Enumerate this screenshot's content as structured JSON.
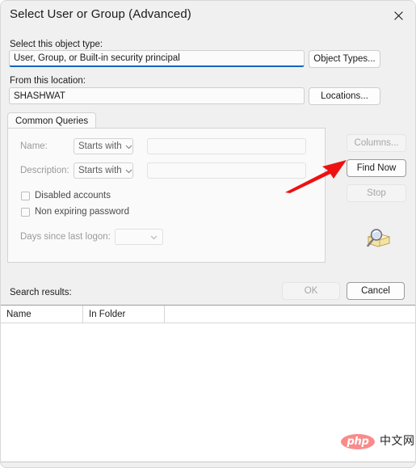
{
  "window": {
    "title": "Select User or Group (Advanced)",
    "close_icon": "close-icon"
  },
  "object_type": {
    "label": "Select this object type:",
    "value": "User, Group, or Built-in security principal",
    "button": "Object Types...",
    "focus_accent": "#1566b8"
  },
  "location": {
    "label": "From this location:",
    "value": "SHASHWAT",
    "button": "Locations..."
  },
  "tabs": [
    {
      "label": "Common Queries",
      "selected": true
    }
  ],
  "query": {
    "name": {
      "label": "Name:",
      "operator": "Starts with",
      "value": "",
      "placeholder": ""
    },
    "description": {
      "label": "Description:",
      "operator": "Starts with",
      "value": "",
      "placeholder": ""
    },
    "checkboxes": [
      {
        "label": "Disabled accounts",
        "checked": false
      },
      {
        "label": "Non expiring password",
        "checked": false
      }
    ],
    "days_since_logon": {
      "label": "Days since last logon:",
      "value": ""
    }
  },
  "side_buttons": [
    {
      "label": "Columns...",
      "enabled": false
    },
    {
      "label": "Find Now",
      "enabled": true,
      "default": true
    },
    {
      "label": "Stop",
      "enabled": false
    }
  ],
  "find_icon": "magnifier-folder-icon",
  "dialog_buttons": [
    {
      "label": "OK",
      "enabled": false
    },
    {
      "label": "Cancel",
      "enabled": true
    }
  ],
  "results": {
    "label": "Search results:",
    "columns": [
      "Name",
      "In Folder"
    ],
    "rows": []
  },
  "annotation": {
    "arrow_color": "#ee1111",
    "points_to": "Find Now"
  },
  "watermark": {
    "badge_text": "php",
    "text": "中文网",
    "badge_color": "#f98b8b"
  }
}
